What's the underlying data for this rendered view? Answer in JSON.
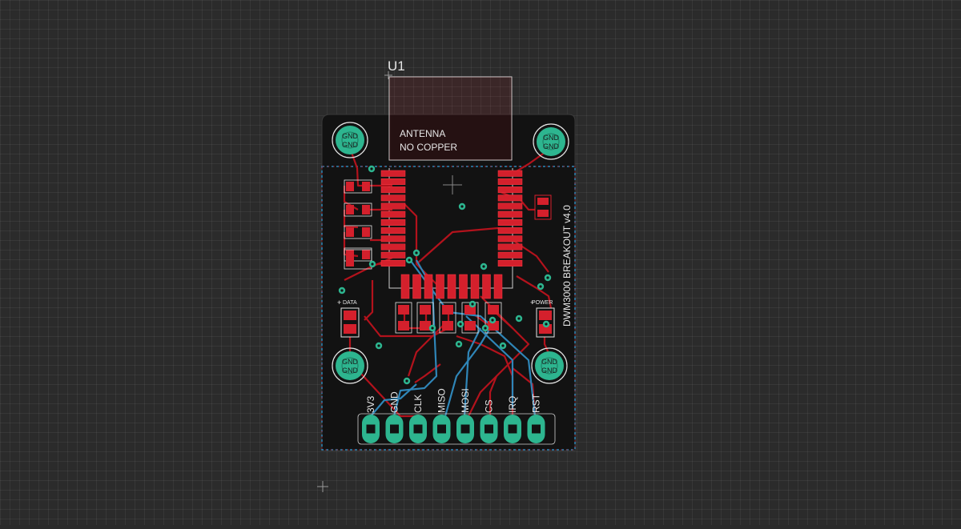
{
  "designator": "U1",
  "keepout_text": [
    "ANTENNA",
    "NO COPPER"
  ],
  "board_label": "DWM3000 BREAKOUT v4.0",
  "led_labels": {
    "left": "DATA",
    "right": "POWER"
  },
  "mounting_hole_label": "GND",
  "pins": [
    {
      "name": "3V3"
    },
    {
      "name": "GND"
    },
    {
      "name": "CLK"
    },
    {
      "name": "MISO"
    },
    {
      "name": "MOSI"
    },
    {
      "name": "CS"
    },
    {
      "name": "IRQ"
    },
    {
      "name": "RST"
    }
  ],
  "colors": {
    "background": "#2b2b2b",
    "board": "#121212",
    "top_copper": "#b3121c",
    "pad_red": "#d4202c",
    "bottom_copper": "#2f86b8",
    "through_hole": "#2db58f",
    "silkscreen": "#e6e6e6"
  }
}
